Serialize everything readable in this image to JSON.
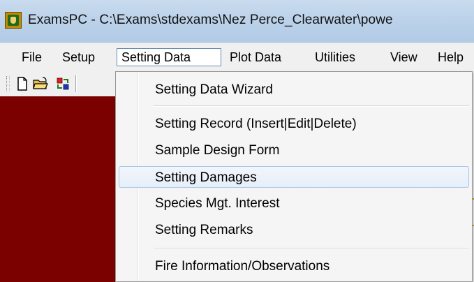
{
  "window": {
    "title": "ExamsPC - C:\\Exams\\stdexams\\Nez Perce_Clearwater\\powe"
  },
  "menubar": {
    "items": [
      "File",
      "Setup",
      "Setting Data",
      "Plot Data",
      "Utilities",
      "View",
      "Help"
    ],
    "active_item": "Setting Data"
  },
  "toolbar": {
    "icons": [
      "new-document-icon",
      "open-folder-icon",
      "transfer-icon"
    ]
  },
  "dropdown": {
    "items": [
      {
        "label": "Setting Data Wizard"
      },
      {
        "label": "Setting Record (Insert|Edit|Delete)"
      },
      {
        "label": "Sample Design Form"
      },
      {
        "label": "Setting Damages"
      },
      {
        "label": "Species Mgt. Interest"
      },
      {
        "label": "Setting Remarks"
      },
      {
        "label": "Fire Information/Observations"
      }
    ],
    "highlighted_item": "Setting Damages"
  },
  "colors": {
    "workarea": "#7b0000",
    "highlight_border": "#a8c6ea"
  }
}
